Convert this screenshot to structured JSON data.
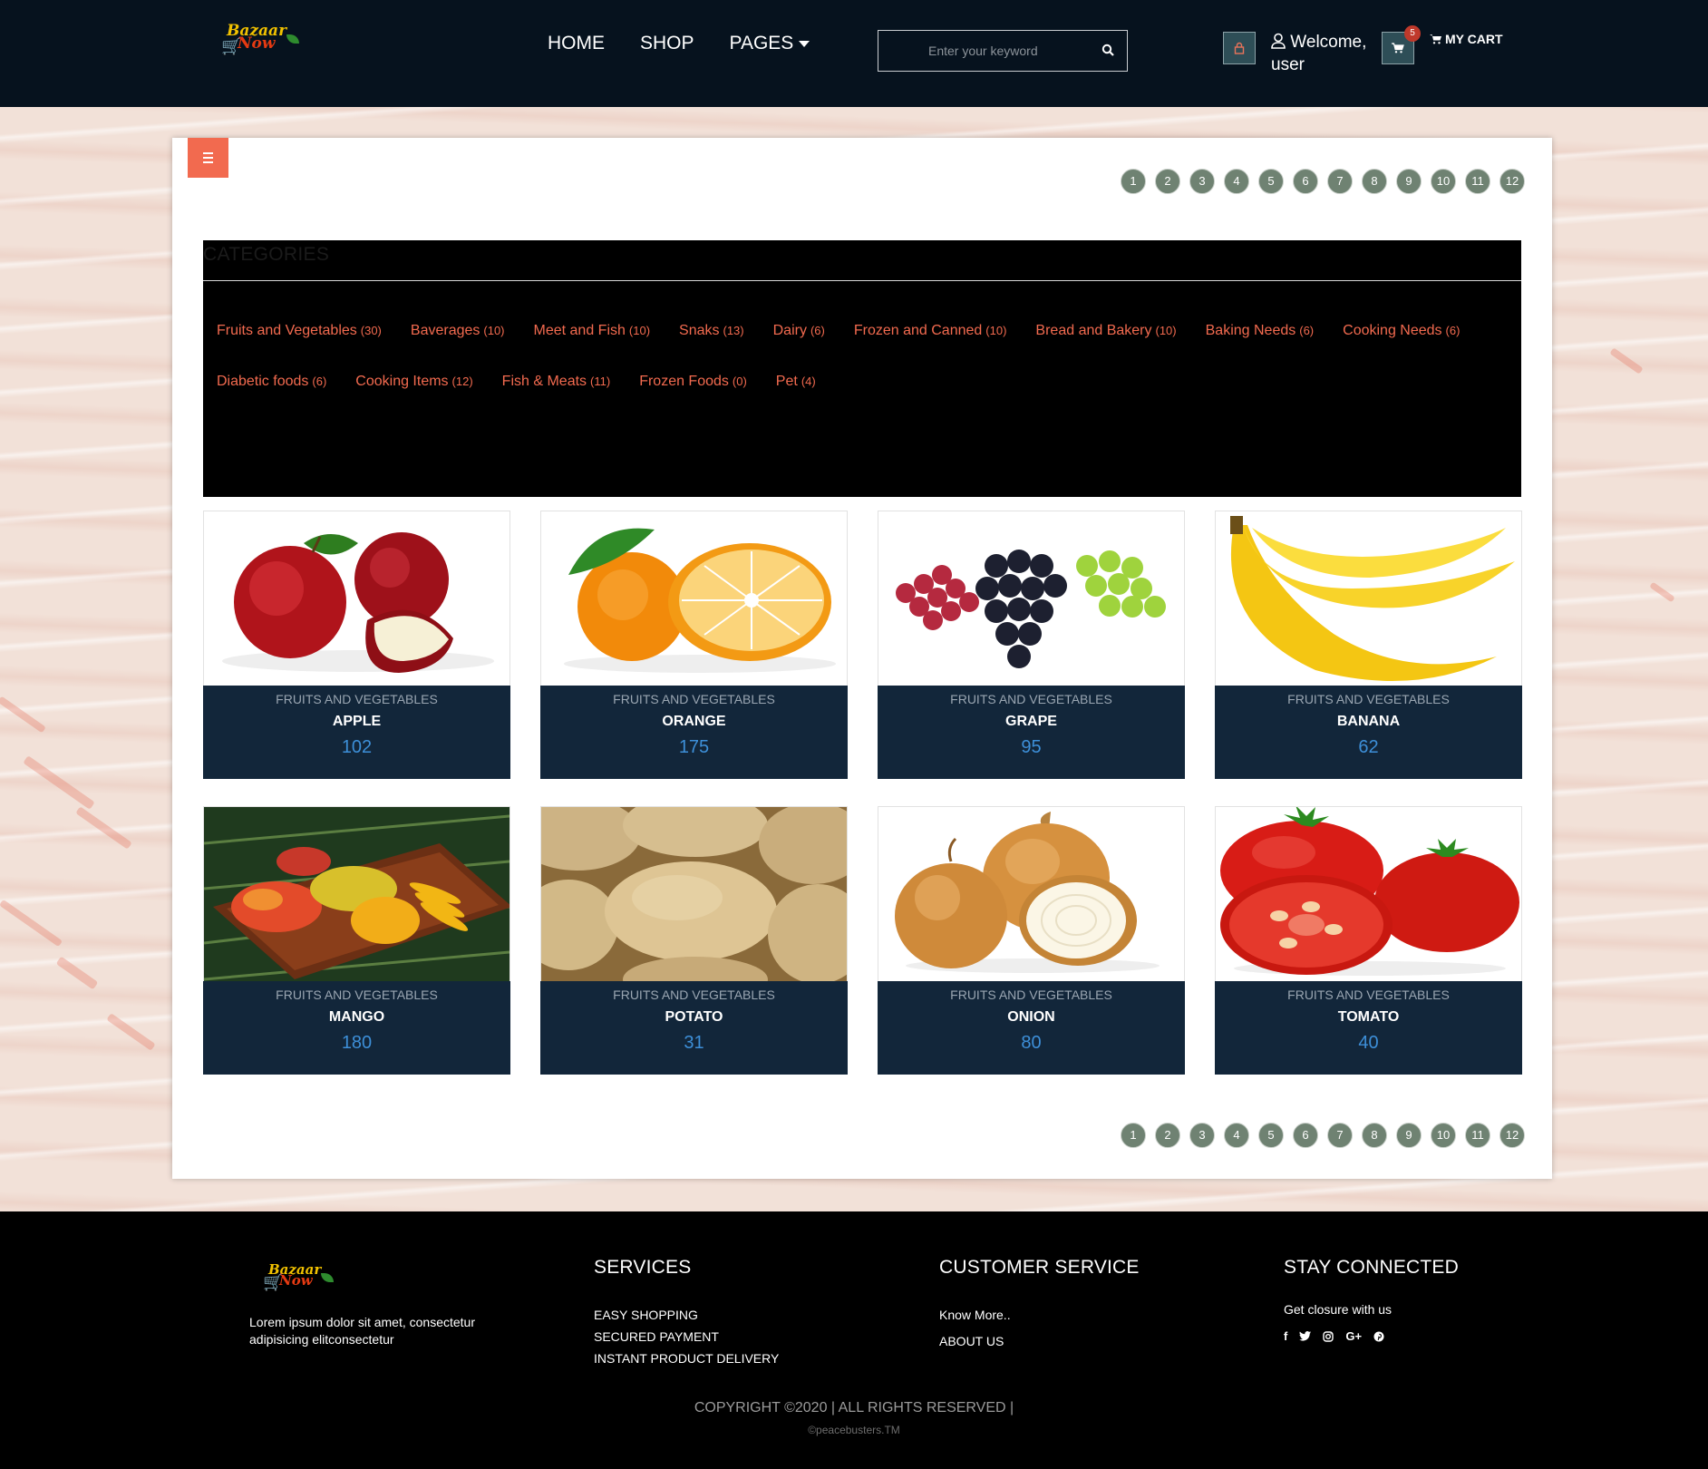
{
  "brand": {
    "line1": "Bazaar",
    "line2": "Now"
  },
  "nav": {
    "home": "HOME",
    "shop": "SHOP",
    "pages": "PAGES"
  },
  "search": {
    "placeholder": "Enter your keyword"
  },
  "user": {
    "welcome_line1": "Welcome,",
    "welcome_line2": "user"
  },
  "cart": {
    "count": "5",
    "label": "MY CART"
  },
  "pagination": [
    "1",
    "2",
    "3",
    "4",
    "5",
    "6",
    "7",
    "8",
    "9",
    "10",
    "11",
    "12"
  ],
  "categories": {
    "title": "CATEGORIES",
    "items": [
      {
        "name": "Fruits and Vegetables",
        "count": "(30)"
      },
      {
        "name": "Baverages",
        "count": "(10)"
      },
      {
        "name": "Meet and Fish",
        "count": "(10)"
      },
      {
        "name": "Snaks",
        "count": "(13)"
      },
      {
        "name": "Dairy",
        "count": "(6)"
      },
      {
        "name": "Frozen and Canned",
        "count": "(10)"
      },
      {
        "name": "Bread and Bakery",
        "count": "(10)"
      },
      {
        "name": "Baking Needs",
        "count": "(6)"
      },
      {
        "name": "Cooking Needs",
        "count": "(6)"
      },
      {
        "name": "Diabetic foods",
        "count": "(6)"
      },
      {
        "name": "Cooking Items",
        "count": "(12)"
      },
      {
        "name": "Fish & Meats",
        "count": "(11)"
      },
      {
        "name": "Frozen Foods",
        "count": "(0)"
      },
      {
        "name": "Pet",
        "count": "(4)"
      }
    ]
  },
  "products": [
    {
      "category": "FRUITS AND VEGETABLES",
      "name": "APPLE",
      "value": "102",
      "image": "apple"
    },
    {
      "category": "FRUITS AND VEGETABLES",
      "name": "ORANGE",
      "value": "175",
      "image": "orange"
    },
    {
      "category": "FRUITS AND VEGETABLES",
      "name": "GRAPE",
      "value": "95",
      "image": "grape"
    },
    {
      "category": "FRUITS AND VEGETABLES",
      "name": "BANANA",
      "value": "62",
      "image": "banana"
    },
    {
      "category": "FRUITS AND VEGETABLES",
      "name": "MANGO",
      "value": "180",
      "image": "mango"
    },
    {
      "category": "FRUITS AND VEGETABLES",
      "name": "POTATO",
      "value": "31",
      "image": "potato"
    },
    {
      "category": "FRUITS AND VEGETABLES",
      "name": "ONION",
      "value": "80",
      "image": "onion"
    },
    {
      "category": "FRUITS AND VEGETABLES",
      "name": "TOMATO",
      "value": "40",
      "image": "tomato"
    }
  ],
  "footer": {
    "about": "Lorem ipsum dolor sit amet, consectetur adipisicing elitconsectetur",
    "services": {
      "title": "SERVICES",
      "links": [
        "EASY SHOPPING",
        "SECURED PAYMENT",
        "INSTANT PRODUCT DELIVERY"
      ]
    },
    "customer_service": {
      "title": "CUSTOMER SERVICE",
      "links": [
        "Know More..",
        "ABOUT US"
      ]
    },
    "stay_connected": {
      "title": "STAY CONNECTED",
      "text": "Get closure with us",
      "social": [
        "facebook-icon",
        "twitter-icon",
        "instagram-icon",
        "google-plus-icon",
        "pinterest-icon"
      ]
    },
    "copyright": "COPYRIGHT ©2020 | ALL RIGHTS RESERVED |",
    "credit": "©peacebusters.TM"
  },
  "colors": {
    "accent": "#f26a4f",
    "header_bg": "#06121e",
    "card_info_bg": "#12263a",
    "value_blue": "#3d8fd8",
    "pager_bg": "#6f8272"
  }
}
